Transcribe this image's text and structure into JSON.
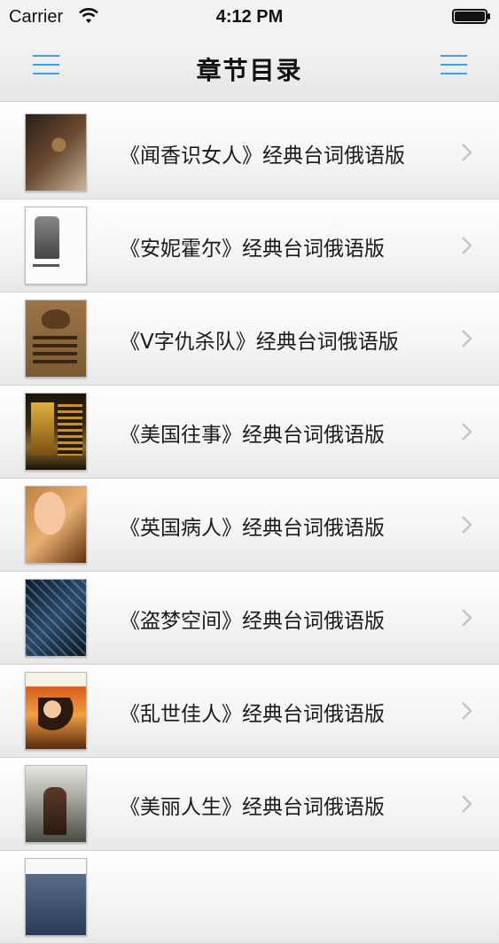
{
  "status_bar": {
    "carrier": "Carrier",
    "time": "4:12 PM",
    "wifi_icon": "wifi-icon",
    "battery_icon": "battery-icon",
    "battery_level_percent": 100
  },
  "nav": {
    "title": "章节目录",
    "left_icon": "menu-icon",
    "right_icon": "menu-icon",
    "accent_color": "#3aa3e3"
  },
  "chapters": [
    {
      "title": "《闻香识女人》经典台词俄语版"
    },
    {
      "title": "《安妮霍尔》经典台词俄语版"
    },
    {
      "title": "《V字仇杀队》经典台词俄语版"
    },
    {
      "title": "《美国往事》经典台词俄语版"
    },
    {
      "title": "《英国病人》经典台词俄语版"
    },
    {
      "title": "《盗梦空间》经典台词俄语版"
    },
    {
      "title": "《乱世佳人》经典台词俄语版"
    },
    {
      "title": "《美丽人生》经典台词俄语版"
    },
    {
      "title": ""
    }
  ]
}
